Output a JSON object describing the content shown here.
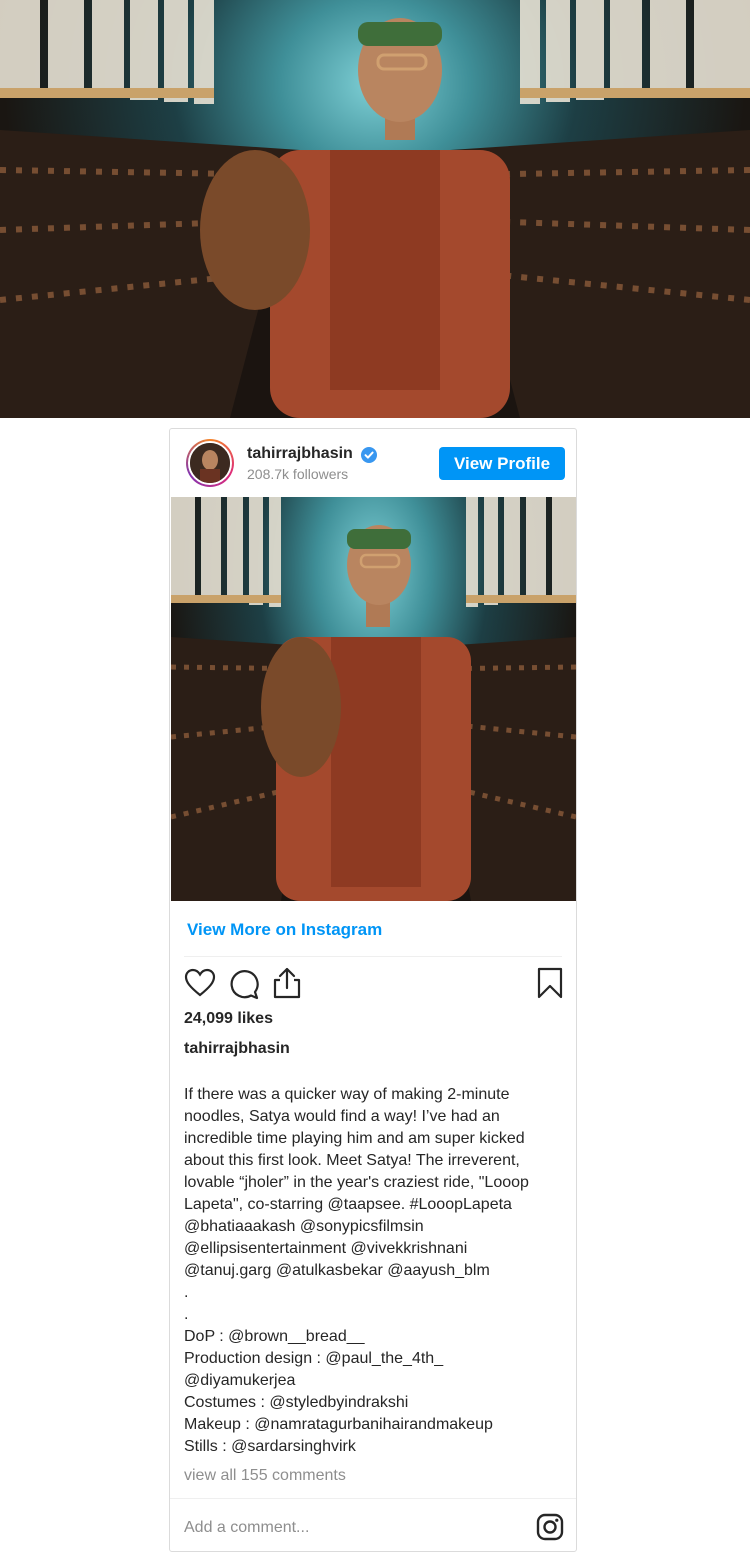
{
  "hero_image": {
    "alt": ""
  },
  "profile": {
    "username": "tahirrajbhasin",
    "followers": "208.7k followers",
    "view_profile_label": "View Profile"
  },
  "post": {
    "view_more_label": "View More on Instagram",
    "likes": "24,099 likes",
    "caption_user": "tahirrajbhasin",
    "caption": "If there was a quicker way of making 2-minute\nnoodles, Satya would find a way! I’ve had an\nincredible time playing him and am super kicked\nabout this first look. Meet Satya! The irreverent,\nlovable “jholer” in the year's craziest ride, \"Looop\nLapeta\", co-starring @taapsee. #LooopLapeta\n@bhatiaaakash @sonypicsfilmsin\n@ellipsisentertainment @vivekkrishnani\n@tanuj.garg @atulkasbekar @aayush_blm\n.\n.\nDoP : @brown__bread__\nProduction design : @paul_the_4th_\n@diyamukerjea\nCostumes : @styledbyindrakshi\nMakeup : @namratagurbanihairandmakeup\nStills : @sardarsinghvirk",
    "view_comments": "view all 155 comments",
    "add_comment_placeholder": "Add a comment..."
  },
  "colors": {
    "accent": "#0095f6",
    "text": "#262626",
    "muted": "#8e8e8e",
    "border": "#dbdbdb"
  }
}
